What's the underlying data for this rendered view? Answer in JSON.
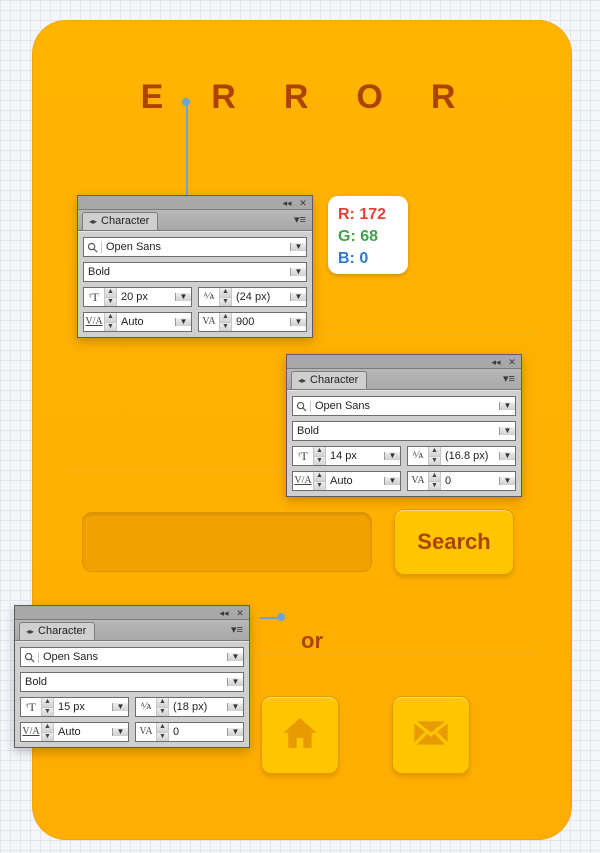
{
  "card": {
    "title": "ERROR",
    "search_button_label": "Search",
    "or_label": "or"
  },
  "rgb_chip": {
    "r_label": "R: 172",
    "g_label": "G: 68",
    "b_label": "B: 0"
  },
  "panel1": {
    "tab_label": "Character",
    "font_family": "Open Sans",
    "font_style": "Bold",
    "font_size": "20 px",
    "leading": "(24 px)",
    "kerning": "Auto",
    "tracking": "900"
  },
  "panel2": {
    "tab_label": "Character",
    "font_family": "Open Sans",
    "font_style": "Bold",
    "font_size": "14 px",
    "leading": "(16.8 px)",
    "kerning": "Auto",
    "tracking": "0"
  },
  "panel3": {
    "tab_label": "Character",
    "font_family": "Open Sans",
    "font_style": "Bold",
    "font_size": "15 px",
    "leading": "(18 px)",
    "kerning": "Auto",
    "tracking": "0"
  }
}
